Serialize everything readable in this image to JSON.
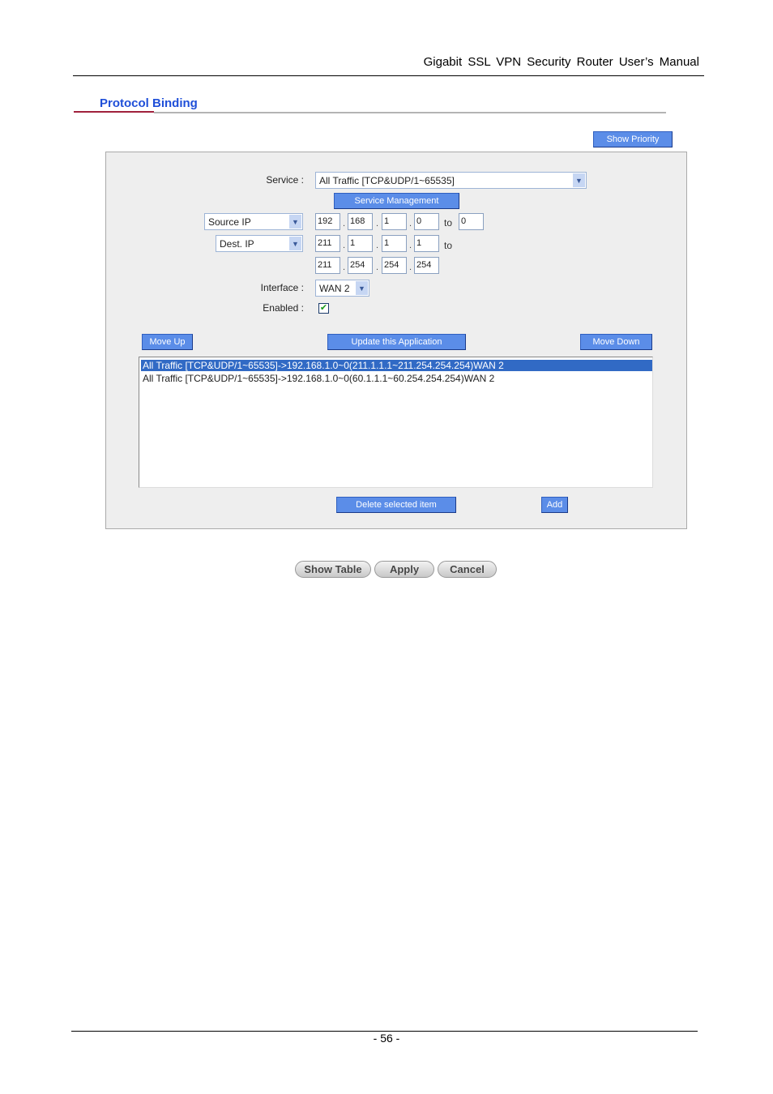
{
  "header": {
    "doc_title": "Gigabit  SSL  VPN  Security  Router  User’s  Manual"
  },
  "section": {
    "title": "Protocol Binding"
  },
  "buttons": {
    "show_priority": "Show Priority",
    "service_management": "Service Management",
    "move_up": "Move Up",
    "update": "Update this Application",
    "move_down": "Move Down",
    "delete": "Delete selected item",
    "add": "Add",
    "show_table": "Show Table",
    "apply": "Apply",
    "cancel": "Cancel"
  },
  "form": {
    "service_label": "Service :",
    "service_value": "All Traffic [TCP&UDP/1~65535]",
    "source_type": "Source IP",
    "source_ip": [
      "192",
      "168",
      "1",
      "0"
    ],
    "source_to": "0",
    "dest_type": "Dest. IP",
    "dest_ip_from": [
      "211",
      "1",
      "1",
      "1"
    ],
    "dest_ip_to": [
      "211",
      "254",
      "254",
      "254"
    ],
    "to_label": "to",
    "interface_label": "Interface :",
    "interface_value": "WAN 2",
    "enabled_label": "Enabled  :",
    "enabled": true
  },
  "list": {
    "items": [
      {
        "text": "All Traffic [TCP&UDP/1~65535]->192.168.1.0~0(211.1.1.1~211.254.254.254)WAN 2",
        "selected": true
      },
      {
        "text": "All Traffic [TCP&UDP/1~65535]->192.168.1.0~0(60.1.1.1~60.254.254.254)WAN 2",
        "selected": false
      }
    ]
  },
  "footer": {
    "page_number": "- 56 -"
  },
  "colors": {
    "title": "#1f4fd8",
    "button": "#5b8de8",
    "selected_row": "#316ac5",
    "panel": "#eeeeee"
  }
}
